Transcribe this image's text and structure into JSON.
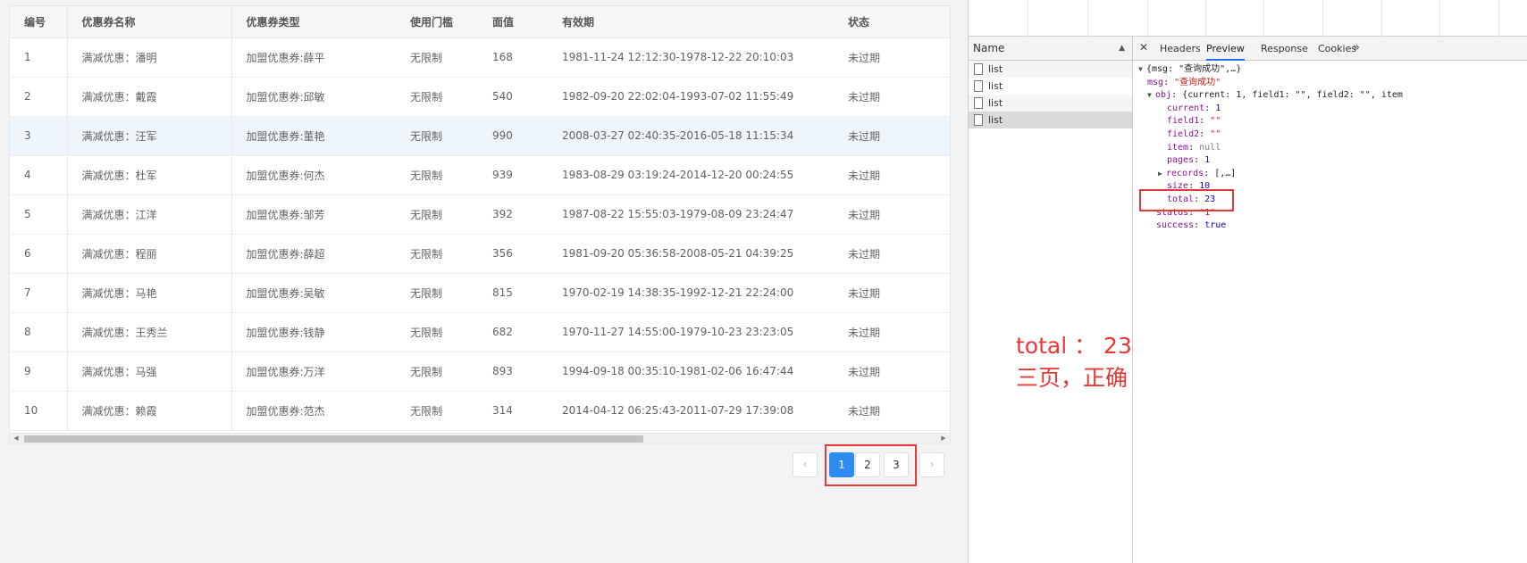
{
  "table": {
    "headers": [
      "编号",
      "优惠券名称",
      "优惠券类型",
      "使用门槛",
      "面值",
      "有效期",
      "状态"
    ],
    "rows": [
      [
        "1",
        "满减优惠：潘明",
        "加盟优惠券:薛平",
        "无限制",
        "168",
        "1981-11-24 12:12:30-1978-12-22 20:10:03",
        "未过期"
      ],
      [
        "2",
        "满减优惠：戴霞",
        "加盟优惠券:邱敏",
        "无限制",
        "540",
        "1982-09-20 22:02:04-1993-07-02 11:55:49",
        "未过期"
      ],
      [
        "3",
        "满减优惠：汪军",
        "加盟优惠券:董艳",
        "无限制",
        "990",
        "2008-03-27 02:40:35-2016-05-18 11:15:34",
        "未过期"
      ],
      [
        "4",
        "满减优惠：杜军",
        "加盟优惠券:何杰",
        "无限制",
        "939",
        "1983-08-29 03:19:24-2014-12-20 00:24:55",
        "未过期"
      ],
      [
        "5",
        "满减优惠：江洋",
        "加盟优惠券:邹芳",
        "无限制",
        "392",
        "1987-08-22 15:55:03-1979-08-09 23:24:47",
        "未过期"
      ],
      [
        "6",
        "满减优惠：程丽",
        "加盟优惠券:薛超",
        "无限制",
        "356",
        "1981-09-20 05:36:58-2008-05-21 04:39:25",
        "未过期"
      ],
      [
        "7",
        "满减优惠：马艳",
        "加盟优惠券:吴敏",
        "无限制",
        "815",
        "1970-02-19 14:38:35-1992-12-21 22:24:00",
        "未过期"
      ],
      [
        "8",
        "满减优惠：王秀兰",
        "加盟优惠券:钱静",
        "无限制",
        "682",
        "1970-11-27 14:55:00-1979-10-23 23:23:05",
        "未过期"
      ],
      [
        "9",
        "满减优惠：马强",
        "加盟优惠券:万洋",
        "无限制",
        "893",
        "1994-09-18 00:35:10-1981-02-06 16:47:44",
        "未过期"
      ],
      [
        "10",
        "满减优惠：赖霞",
        "加盟优惠券:范杰",
        "无限制",
        "314",
        "2014-04-12 06:25:43-2011-07-29 17:39:08",
        "未过期"
      ]
    ],
    "highlighted_row": 3
  },
  "pagination": {
    "prev": "‹",
    "pages": [
      "1",
      "2",
      "3"
    ],
    "current": "1",
    "next": "›"
  },
  "devtools": {
    "name_header": "Name",
    "sort_glyph": "▲",
    "requests": [
      "list",
      "list",
      "list",
      "list"
    ],
    "selected_request": 4,
    "close_glyph": "✕",
    "tabs": [
      "Headers",
      "Preview",
      "Response",
      "Cookies"
    ],
    "active_tab": "Preview",
    "more_glyph": "»",
    "preview": {
      "root": "{msg: \"查询成功\",…}",
      "msg_key": "msg",
      "msg_val": "\"查询成功\"",
      "obj_key": "obj",
      "obj_summary": "{current: 1, field1: \"\", field2: \"\", item",
      "current_key": "current",
      "current_val": "1",
      "field1_key": "field1",
      "field1_val": "\"\"",
      "field2_key": "field2",
      "field2_val": "\"\"",
      "item_key": "item",
      "item_val": "null",
      "pages_key": "pages",
      "pages_val": "1",
      "records_key": "records",
      "records_val": "[,…]",
      "size_key": "size",
      "size_val": "10",
      "total_key": "total",
      "total_val": "23",
      "status_key": "status",
      "status_val": "\"1\"",
      "success_key": "success",
      "success_val": "true"
    }
  },
  "annotation": {
    "line1": "total ： 23",
    "line2": "三页，正确"
  },
  "colors": {
    "accent": "#2d8cf0",
    "annotation": "#e53935",
    "row_highlight": "#eef6fc"
  }
}
